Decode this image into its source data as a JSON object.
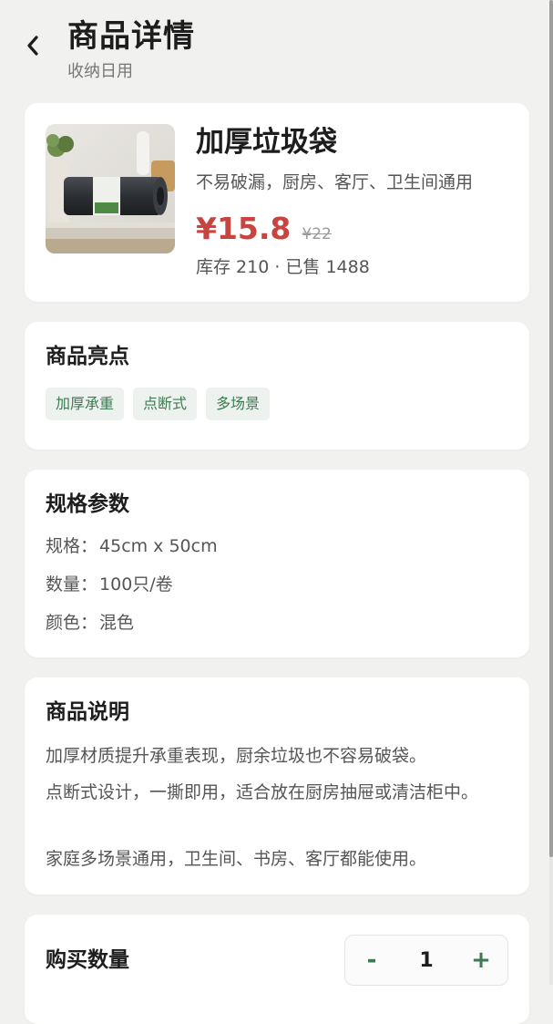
{
  "header": {
    "back_icon": "chevron-left-icon",
    "title": "商品详情",
    "subtitle": "收纳日用"
  },
  "product": {
    "image_icon": "trash-bag-roll-photo",
    "name": "加厚垃圾袋",
    "tagline": "不易破漏，厨房、客厅、卫生间通用",
    "price": "¥15.8",
    "original_price": "¥22",
    "stock_line": "库存 210 · 已售 1488",
    "price_color": "#c7443f"
  },
  "highlights": {
    "title": "商品亮点",
    "tags": [
      "加厚承重",
      "点断式",
      "多场景"
    ],
    "tag_color": "#3d7a52"
  },
  "specs": {
    "title": "规格参数",
    "rows": [
      {
        "label": "规格：",
        "value": "45cm x 50cm"
      },
      {
        "label": "数量：",
        "value": "100只/卷"
      },
      {
        "label": "颜色：",
        "value": "混色"
      }
    ]
  },
  "description": {
    "title": "商品说明",
    "paragraphs": [
      "加厚材质提升承重表现，厨余垃圾也不容易破袋。",
      "点断式设计，一撕即用，适合放在厨房抽屉或清洁柜中。",
      "家庭多场景通用，卫生间、书房、客厅都能使用。"
    ]
  },
  "purchase": {
    "title": "购买数量",
    "decrease_label": "-",
    "quantity": "1",
    "increase_label": "+"
  }
}
